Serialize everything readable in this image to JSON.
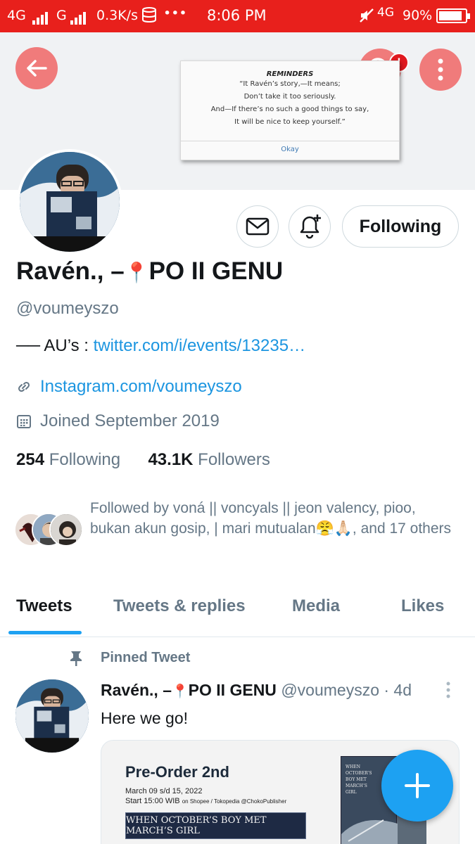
{
  "status_bar": {
    "left_text_1": "4G",
    "left_text_2": "G",
    "speed": "0.3K/s",
    "dots": "•••",
    "time": "8:06 PM",
    "network_right": "4G",
    "battery": "90%",
    "battery_level": 0.9
  },
  "dialog": {
    "title": "REMINDERS",
    "lines": [
      "“It Ravén’s story,—It means;",
      "Don’t take it too seriously.",
      "And—If there’s no such a good things to say,",
      "It will be nice to keep yourself.”"
    ],
    "ok_label": "Okay"
  },
  "header": {
    "notification_badge": "!"
  },
  "profile": {
    "follow_button_label": "Following",
    "name_prefix": "Ravén., –",
    "pin_emoji": "📍",
    "name_suffix": "PO II GENU",
    "handle": "@voumeyszo",
    "bio_prefix": "── AU’s : ",
    "bio_link": "twitter.com/i/events/13235…",
    "website": "Instagram.com/voumeyszo",
    "joined": "Joined September 2019",
    "following_count": "254",
    "following_label": "Following",
    "followers_count": "43.1K",
    "followers_label": "Followers",
    "followed_by": "Followed by voná || voncyals || jeon valency, pioo, bukan akun gosip,  | mari mutualan😤🙏🏻, and 17 others"
  },
  "tabs": [
    {
      "label": "Tweets",
      "active": true
    },
    {
      "label": "Tweets & replies",
      "active": false
    },
    {
      "label": "Media",
      "active": false
    },
    {
      "label": "Likes",
      "active": false
    }
  ],
  "tweet": {
    "pinned_label": "Pinned Tweet",
    "author_prefix": "Ravén., –",
    "author_emoji": "📍",
    "author_suffix": "PO II GENU",
    "handle_time": "@voumeyszo · 4d",
    "text": "Here we go!",
    "media": {
      "title": "Pre-Order 2nd",
      "date_line": "March 09 s/d 15, 2022",
      "time_line": "Start 15:00 WIB",
      "time_small": "on Shopee / Tokopedia @ChokoPublisher",
      "banner": "WHEN OCTOBER’S BOY MET MARCH’S GIRL",
      "book_title": "WHEN OCTOBER’S BOY MET MARCH’S GIRL"
    }
  },
  "colors": {
    "status_bar": "#e8201c",
    "accent": "#1da1f2",
    "round_button": "#f07b7b"
  }
}
